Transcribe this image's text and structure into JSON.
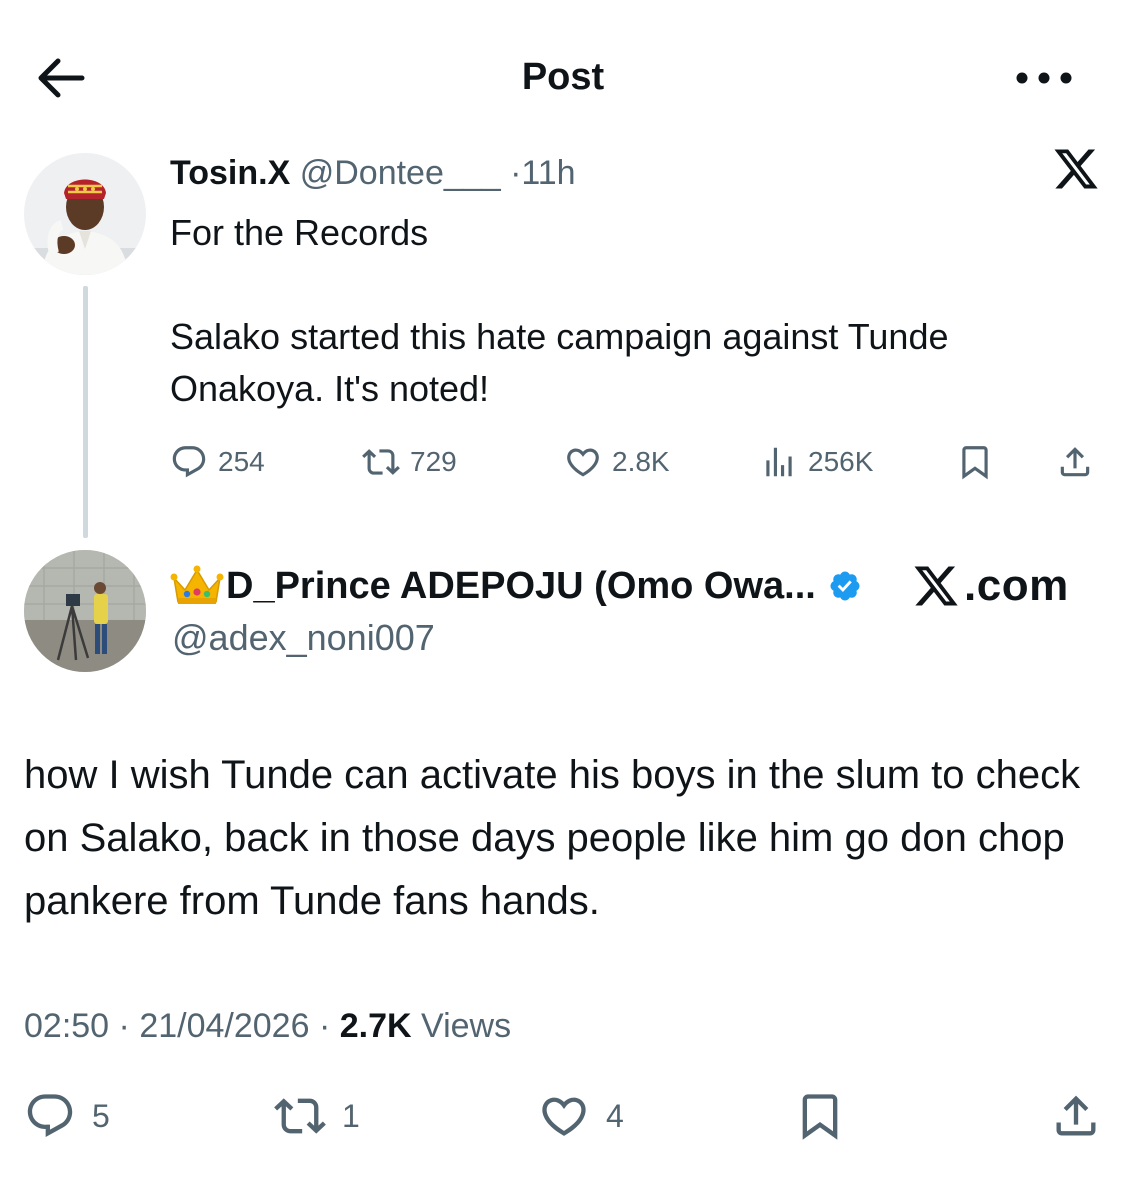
{
  "header": {
    "title": "Post"
  },
  "quoted_post": {
    "display_name": "Tosin.X",
    "handle": "@Dontee___",
    "separator": "·",
    "time": "11h",
    "text_line1": "For the Records",
    "text_line2": "Salako started this hate campaign against Tunde Onakoya.  It's noted!",
    "stats": {
      "replies": "254",
      "reposts": "729",
      "likes": "2.8K",
      "views": "256K"
    }
  },
  "main_post": {
    "display_name": "D_Prince ADEPOJU (Omo Owa...",
    "handle": "@adex_noni007",
    "source_label": ".com",
    "text": "how I wish Tunde can activate his boys in the slum to check on Salako, back in those days people like him go don chop pankere from Tunde fans hands.",
    "time": "02:50",
    "date": "21/04/2026",
    "separator": "·",
    "views_count": "2.7K",
    "views_label": "Views",
    "stats": {
      "replies": "5",
      "reposts": "1",
      "likes": "4"
    }
  },
  "icons": {
    "back": "arrow-left-icon",
    "more": "more-icon",
    "x_logo": "x-logo-icon",
    "reply": "reply-icon",
    "repost": "repost-icon",
    "like": "heart-icon",
    "views": "views-icon",
    "bookmark": "bookmark-icon",
    "share": "share-icon",
    "verified": "verified-badge-icon",
    "crown": "crown-emoji-icon"
  },
  "colors": {
    "verified": "#1d9bf0",
    "muted": "#536471",
    "text": "#0f1419",
    "thread_line": "#cfd9de"
  }
}
